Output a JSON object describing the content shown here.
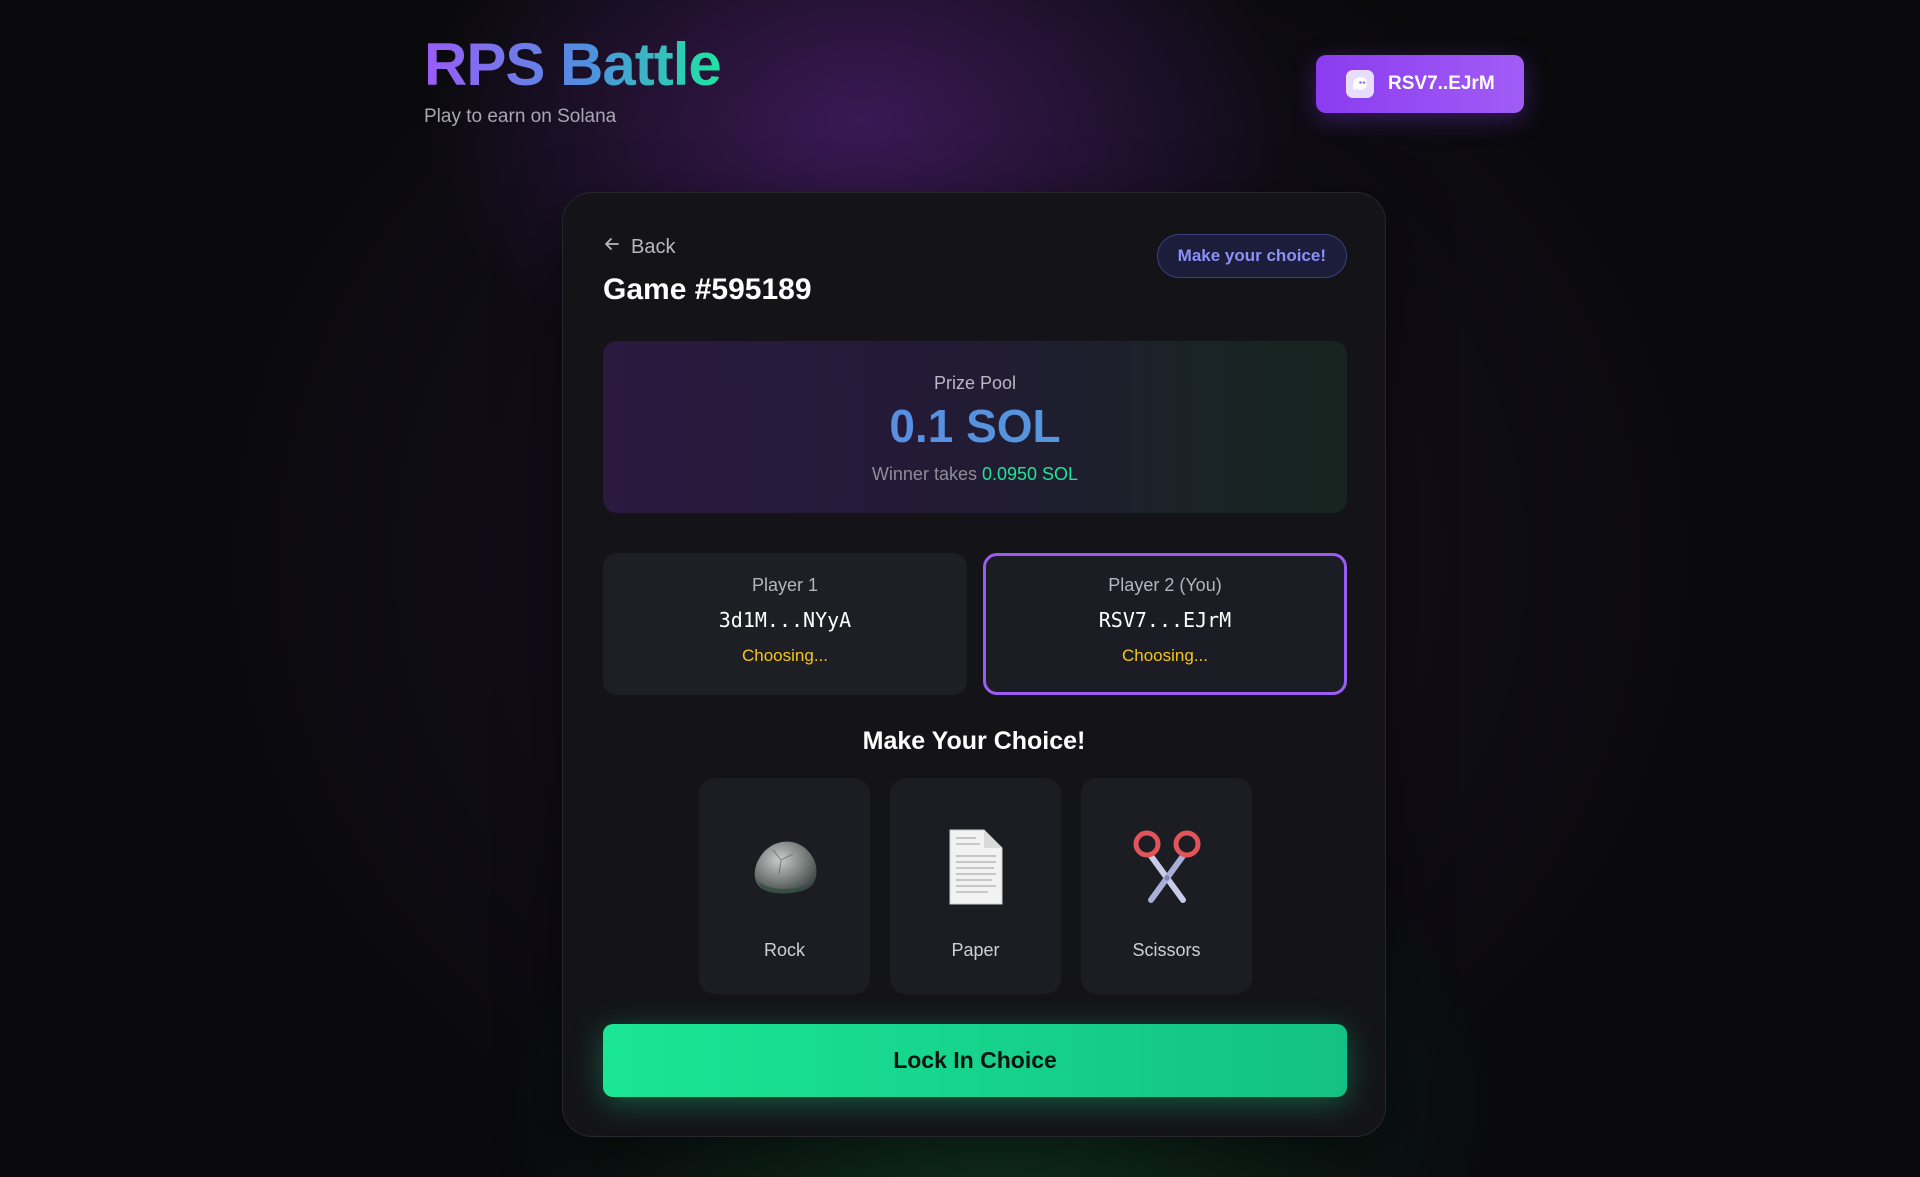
{
  "header": {
    "title": "RPS Battle",
    "subtitle": "Play to earn on Solana",
    "wallet_label": "RSV7..EJrM",
    "wallet_icon": "ghost-icon"
  },
  "game": {
    "back_label": "Back",
    "title": "Game #595189",
    "status": "Make your choice!"
  },
  "prize": {
    "label": "Prize Pool",
    "amount": "0.1 SOL",
    "winner_prefix": "Winner takes",
    "winner_amount": "0.0950 SOL"
  },
  "players": [
    {
      "label": "Player 1",
      "address": "3d1M...NYyA",
      "status": "Choosing..."
    },
    {
      "label": "Player 2 (You)",
      "address": "RSV7...EJrM",
      "status": "Choosing..."
    }
  ],
  "choices": {
    "heading": "Make Your Choice!",
    "options": [
      {
        "label": "Rock",
        "icon": "rock-icon"
      },
      {
        "label": "Paper",
        "icon": "paper-icon"
      },
      {
        "label": "Scissors",
        "icon": "scissors-icon"
      }
    ]
  },
  "lock_button": "Lock In Choice",
  "colors": {
    "accent_purple": "#9a5cf2",
    "accent_green": "#1ae694",
    "status_yellow": "#f5c518",
    "pill_text": "#8c8ff7"
  }
}
